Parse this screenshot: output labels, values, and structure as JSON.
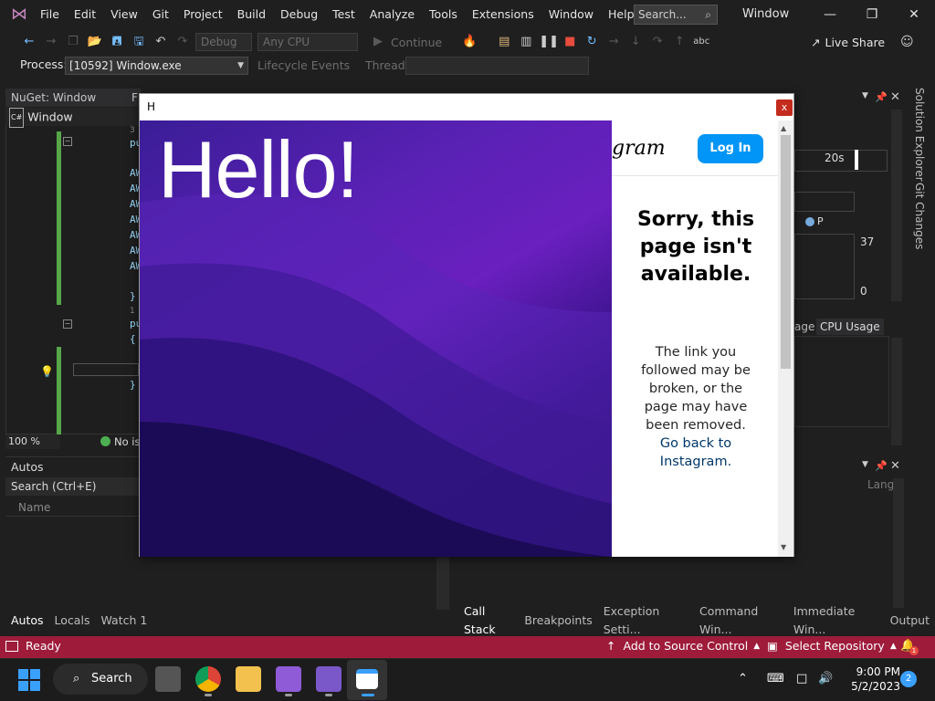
{
  "menu": [
    "File",
    "Edit",
    "View",
    "Git",
    "Project",
    "Build",
    "Debug",
    "Test",
    "Analyze",
    "Tools",
    "Extensions",
    "Window",
    "Help"
  ],
  "search_placeholder": "Search...",
  "window_title": "Window",
  "toolbar": {
    "config": "Debug",
    "platform": "Any CPU",
    "continue_label": "Continue",
    "live_share": "Live Share"
  },
  "process": {
    "label": "Process:",
    "value": "[10592] Window.exe",
    "lifecycle": "Lifecycle Events",
    "thread_label": "Thread:"
  },
  "editor": {
    "nuget_tab": "NuGet: Window",
    "f_tab": "F",
    "window_tab": "Window",
    "zoom": "100 %",
    "issues": "No is",
    "code_lines": [
      "pu",
      "AW",
      "AW",
      "AW",
      "AW",
      "AW",
      "AW",
      "AW",
      "}",
      "pu",
      "{",
      "}"
    ],
    "refs": [
      "3",
      "1"
    ]
  },
  "autos": {
    "title": "Autos",
    "search": "Search (Ctrl+E)",
    "name_col": "Name",
    "tabs": [
      "Autos",
      "Locals",
      "Watch 1"
    ]
  },
  "right_tabs": [
    "Call Stack",
    "Breakpoints",
    "Exception Setti...",
    "Command Win...",
    "Immediate Win...",
    "Output"
  ],
  "side_panel": {
    "solution_explorer": "Solution Explorer",
    "git_changes": "Git Changes",
    "time": "20s",
    "legend": "P",
    "max": "37",
    "min": "0",
    "tab_partial": "age",
    "cpu_tab": "CPU Usage",
    "lang": "Lang"
  },
  "status": {
    "ready": "Ready",
    "add_source": "Add to Source Control",
    "select_repo": "Select Repository",
    "notifications": "1"
  },
  "taskbar": {
    "search": "Search",
    "time": "9:00 PM",
    "date": "5/2/2023",
    "badge": "2"
  },
  "popup": {
    "title": "H",
    "close": "x",
    "hello": "Hello!",
    "ig_logo": "gram",
    "login": "Log In",
    "sorry": "Sorry, this page isn't available.",
    "body": "The link you followed may be broken, or the page may have been removed.",
    "link": "Go back to Instagram."
  }
}
